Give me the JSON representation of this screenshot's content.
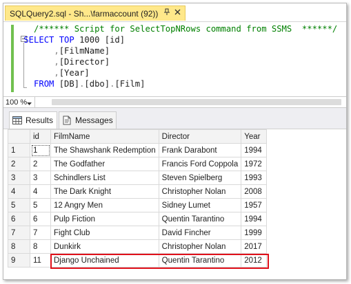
{
  "document_tab": {
    "title": "SQLQuery2.sql - Sh...\\farmaccount (92))",
    "pin_icon": "pin-icon",
    "close_icon": "close-icon"
  },
  "editor": {
    "lines": [
      {
        "indent": "   ",
        "parts": [
          {
            "t": "/****** Script for SelectTopNRows command from SSMS  ******/",
            "c": "cm"
          }
        ]
      },
      {
        "indent": " ",
        "parts": [
          {
            "t": "SELECT",
            "c": "kw"
          },
          {
            "t": " ",
            "c": "tx"
          },
          {
            "t": "TOP",
            "c": "kw"
          },
          {
            "t": " 1000 [id]",
            "c": "tx"
          }
        ]
      },
      {
        "indent": "       ",
        "parts": [
          {
            "t": ",",
            "c": "gr"
          },
          {
            "t": "[FilmName]",
            "c": "tx"
          }
        ]
      },
      {
        "indent": "       ",
        "parts": [
          {
            "t": ",",
            "c": "gr"
          },
          {
            "t": "[Director]",
            "c": "tx"
          }
        ]
      },
      {
        "indent": "       ",
        "parts": [
          {
            "t": ",",
            "c": "gr"
          },
          {
            "t": "[Year]",
            "c": "tx"
          }
        ]
      },
      {
        "indent": "   ",
        "parts": [
          {
            "t": "FROM",
            "c": "kw"
          },
          {
            "t": " [DB]",
            "c": "tx"
          },
          {
            "t": ".",
            "c": "gr"
          },
          {
            "t": "[dbo]",
            "c": "tx"
          },
          {
            "t": ".",
            "c": "gr"
          },
          {
            "t": "[Film]",
            "c": "tx"
          }
        ]
      }
    ]
  },
  "zoom": {
    "value": "100 %"
  },
  "results_tabs": {
    "results_label": "Results",
    "messages_label": "Messages"
  },
  "grid": {
    "columns": [
      "",
      "id",
      "FilmName",
      "Director",
      "Year"
    ],
    "rows": [
      [
        "1",
        "1",
        "The Shawshank Redemption",
        "Frank Darabont",
        "1994"
      ],
      [
        "2",
        "2",
        "The Godfather",
        "Francis Ford Coppola",
        "1972"
      ],
      [
        "3",
        "3",
        "Schindlers List",
        "Steven Spielberg",
        "1993"
      ],
      [
        "4",
        "4",
        "The Dark Knight",
        "Christopher Nolan",
        "2008"
      ],
      [
        "5",
        "5",
        "12 Angry Men",
        "Sidney Lumet",
        "1957"
      ],
      [
        "6",
        "6",
        "Pulp Fiction",
        "Quentin Tarantino",
        "1994"
      ],
      [
        "7",
        "7",
        "Fight Club",
        "David Fincher",
        "1999"
      ],
      [
        "8",
        "8",
        "Dunkirk",
        "Christopher Nolan",
        "2017"
      ],
      [
        "9",
        "11",
        "Django Unchained",
        "Quentin Tarantino",
        "2012"
      ]
    ],
    "highlighted_row_index": 8,
    "highlight_color": "#e0101a"
  },
  "colors": {
    "tab_active": "#ffe88a",
    "keyword": "#0000ff",
    "comment": "#008000",
    "change_bar": "#71c04f"
  }
}
